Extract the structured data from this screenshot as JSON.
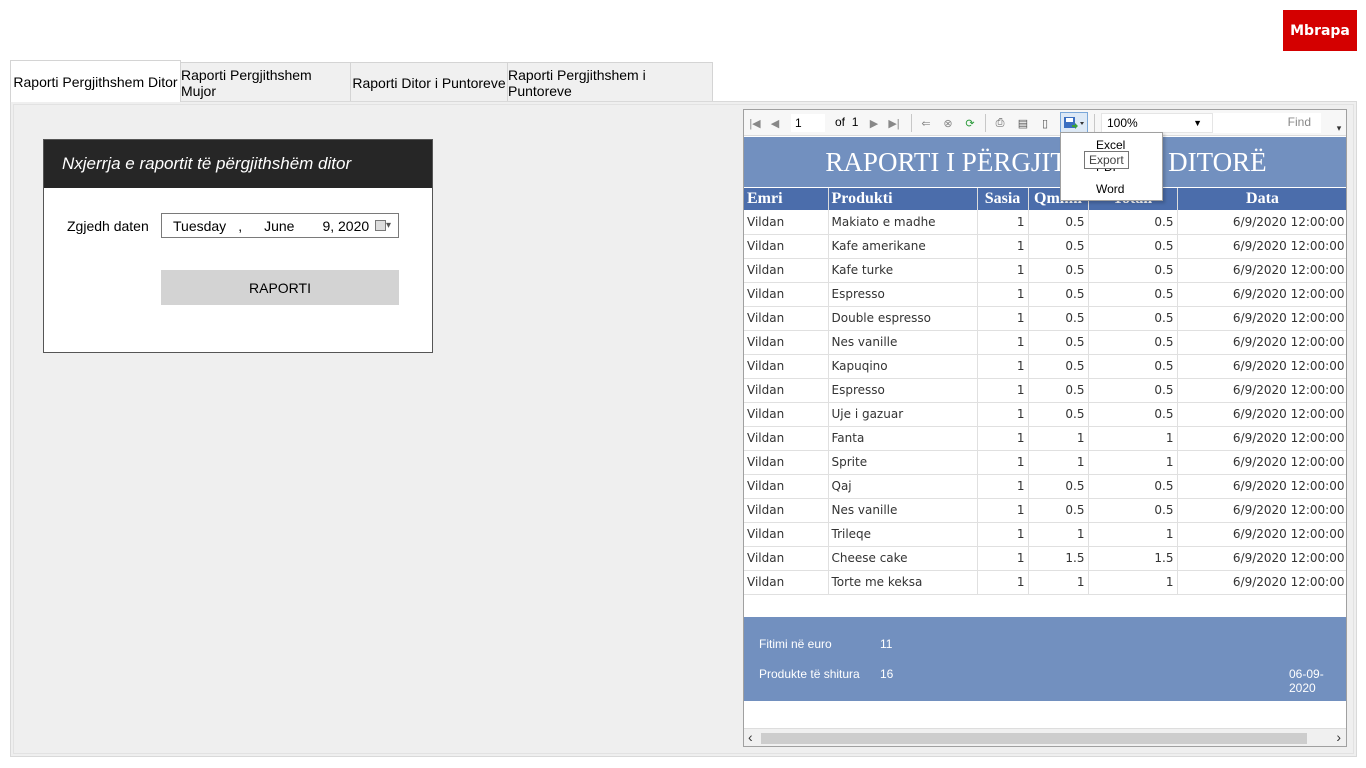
{
  "back_button": "Mbrapa",
  "tabs": [
    "Raporti Pergjithshem Ditor",
    "Raporti Pergjithshem Mujor",
    "Raporti Ditor i Puntoreve",
    "Raporti Pergjithshem i Puntoreve"
  ],
  "form": {
    "header": "Nxjerrja e raportit të përgjithshëm ditor",
    "date_label": "Zgjedh daten",
    "date": {
      "day": "Tuesday",
      "comma": ",",
      "month": "June",
      "date": "9, 2020"
    },
    "button": "RAPORTI"
  },
  "viewer": {
    "page": "1",
    "of": "of",
    "total_pages": "1",
    "zoom": "100%",
    "find": "Find",
    "export_menu": [
      "Excel",
      "PDF",
      "Word"
    ],
    "tooltip": "Export",
    "title": "RAPORTI I PËRGJITHSHËM DITORË",
    "columns": [
      "Emri",
      "Produkti",
      "Sasia",
      "Qmimi",
      "Totali",
      "Data"
    ],
    "rows": [
      [
        "Vildan",
        "Makiato e madhe",
        "1",
        "0.5",
        "0.5",
        "6/9/2020 12:00:00"
      ],
      [
        "Vildan",
        "Kafe amerikane",
        "1",
        "0.5",
        "0.5",
        "6/9/2020 12:00:00"
      ],
      [
        "Vildan",
        "Kafe turke",
        "1",
        "0.5",
        "0.5",
        "6/9/2020 12:00:00"
      ],
      [
        "Vildan",
        "Espresso",
        "1",
        "0.5",
        "0.5",
        "6/9/2020 12:00:00"
      ],
      [
        "Vildan",
        "Double espresso",
        "1",
        "0.5",
        "0.5",
        "6/9/2020 12:00:00"
      ],
      [
        "Vildan",
        "Nes vanille",
        "1",
        "0.5",
        "0.5",
        "6/9/2020 12:00:00"
      ],
      [
        "Vildan",
        "Kapuqino",
        "1",
        "0.5",
        "0.5",
        "6/9/2020 12:00:00"
      ],
      [
        "Vildan",
        "Espresso",
        "1",
        "0.5",
        "0.5",
        "6/9/2020 12:00:00"
      ],
      [
        "Vildan",
        "Uje i gazuar",
        "1",
        "0.5",
        "0.5",
        "6/9/2020 12:00:00"
      ],
      [
        "Vildan",
        "Fanta",
        "1",
        "1",
        "1",
        "6/9/2020 12:00:00"
      ],
      [
        "Vildan",
        "Sprite",
        "1",
        "1",
        "1",
        "6/9/2020 12:00:00"
      ],
      [
        "Vildan",
        "Qaj",
        "1",
        "0.5",
        "0.5",
        "6/9/2020 12:00:00"
      ],
      [
        "Vildan",
        "Nes vanille",
        "1",
        "0.5",
        "0.5",
        "6/9/2020 12:00:00"
      ],
      [
        "Vildan",
        "Trileqe",
        "1",
        "1",
        "1",
        "6/9/2020 12:00:00"
      ],
      [
        "Vildan",
        "Cheese cake",
        "1",
        "1.5",
        "1.5",
        "6/9/2020 12:00:00"
      ],
      [
        "Vildan",
        "Torte me keksa",
        "1",
        "1",
        "1",
        "6/9/2020 12:00:00"
      ]
    ],
    "summary": {
      "profit_label": "Fitimi në euro",
      "profit_value": "11",
      "sold_label": "Produkte të shitura",
      "sold_value": "16",
      "date": "06-09-2020"
    }
  },
  "colors": {
    "accent_red": "#d40000",
    "header_dark": "#262626",
    "report_blue": "#7290bf",
    "table_header": "#4b6dab"
  }
}
